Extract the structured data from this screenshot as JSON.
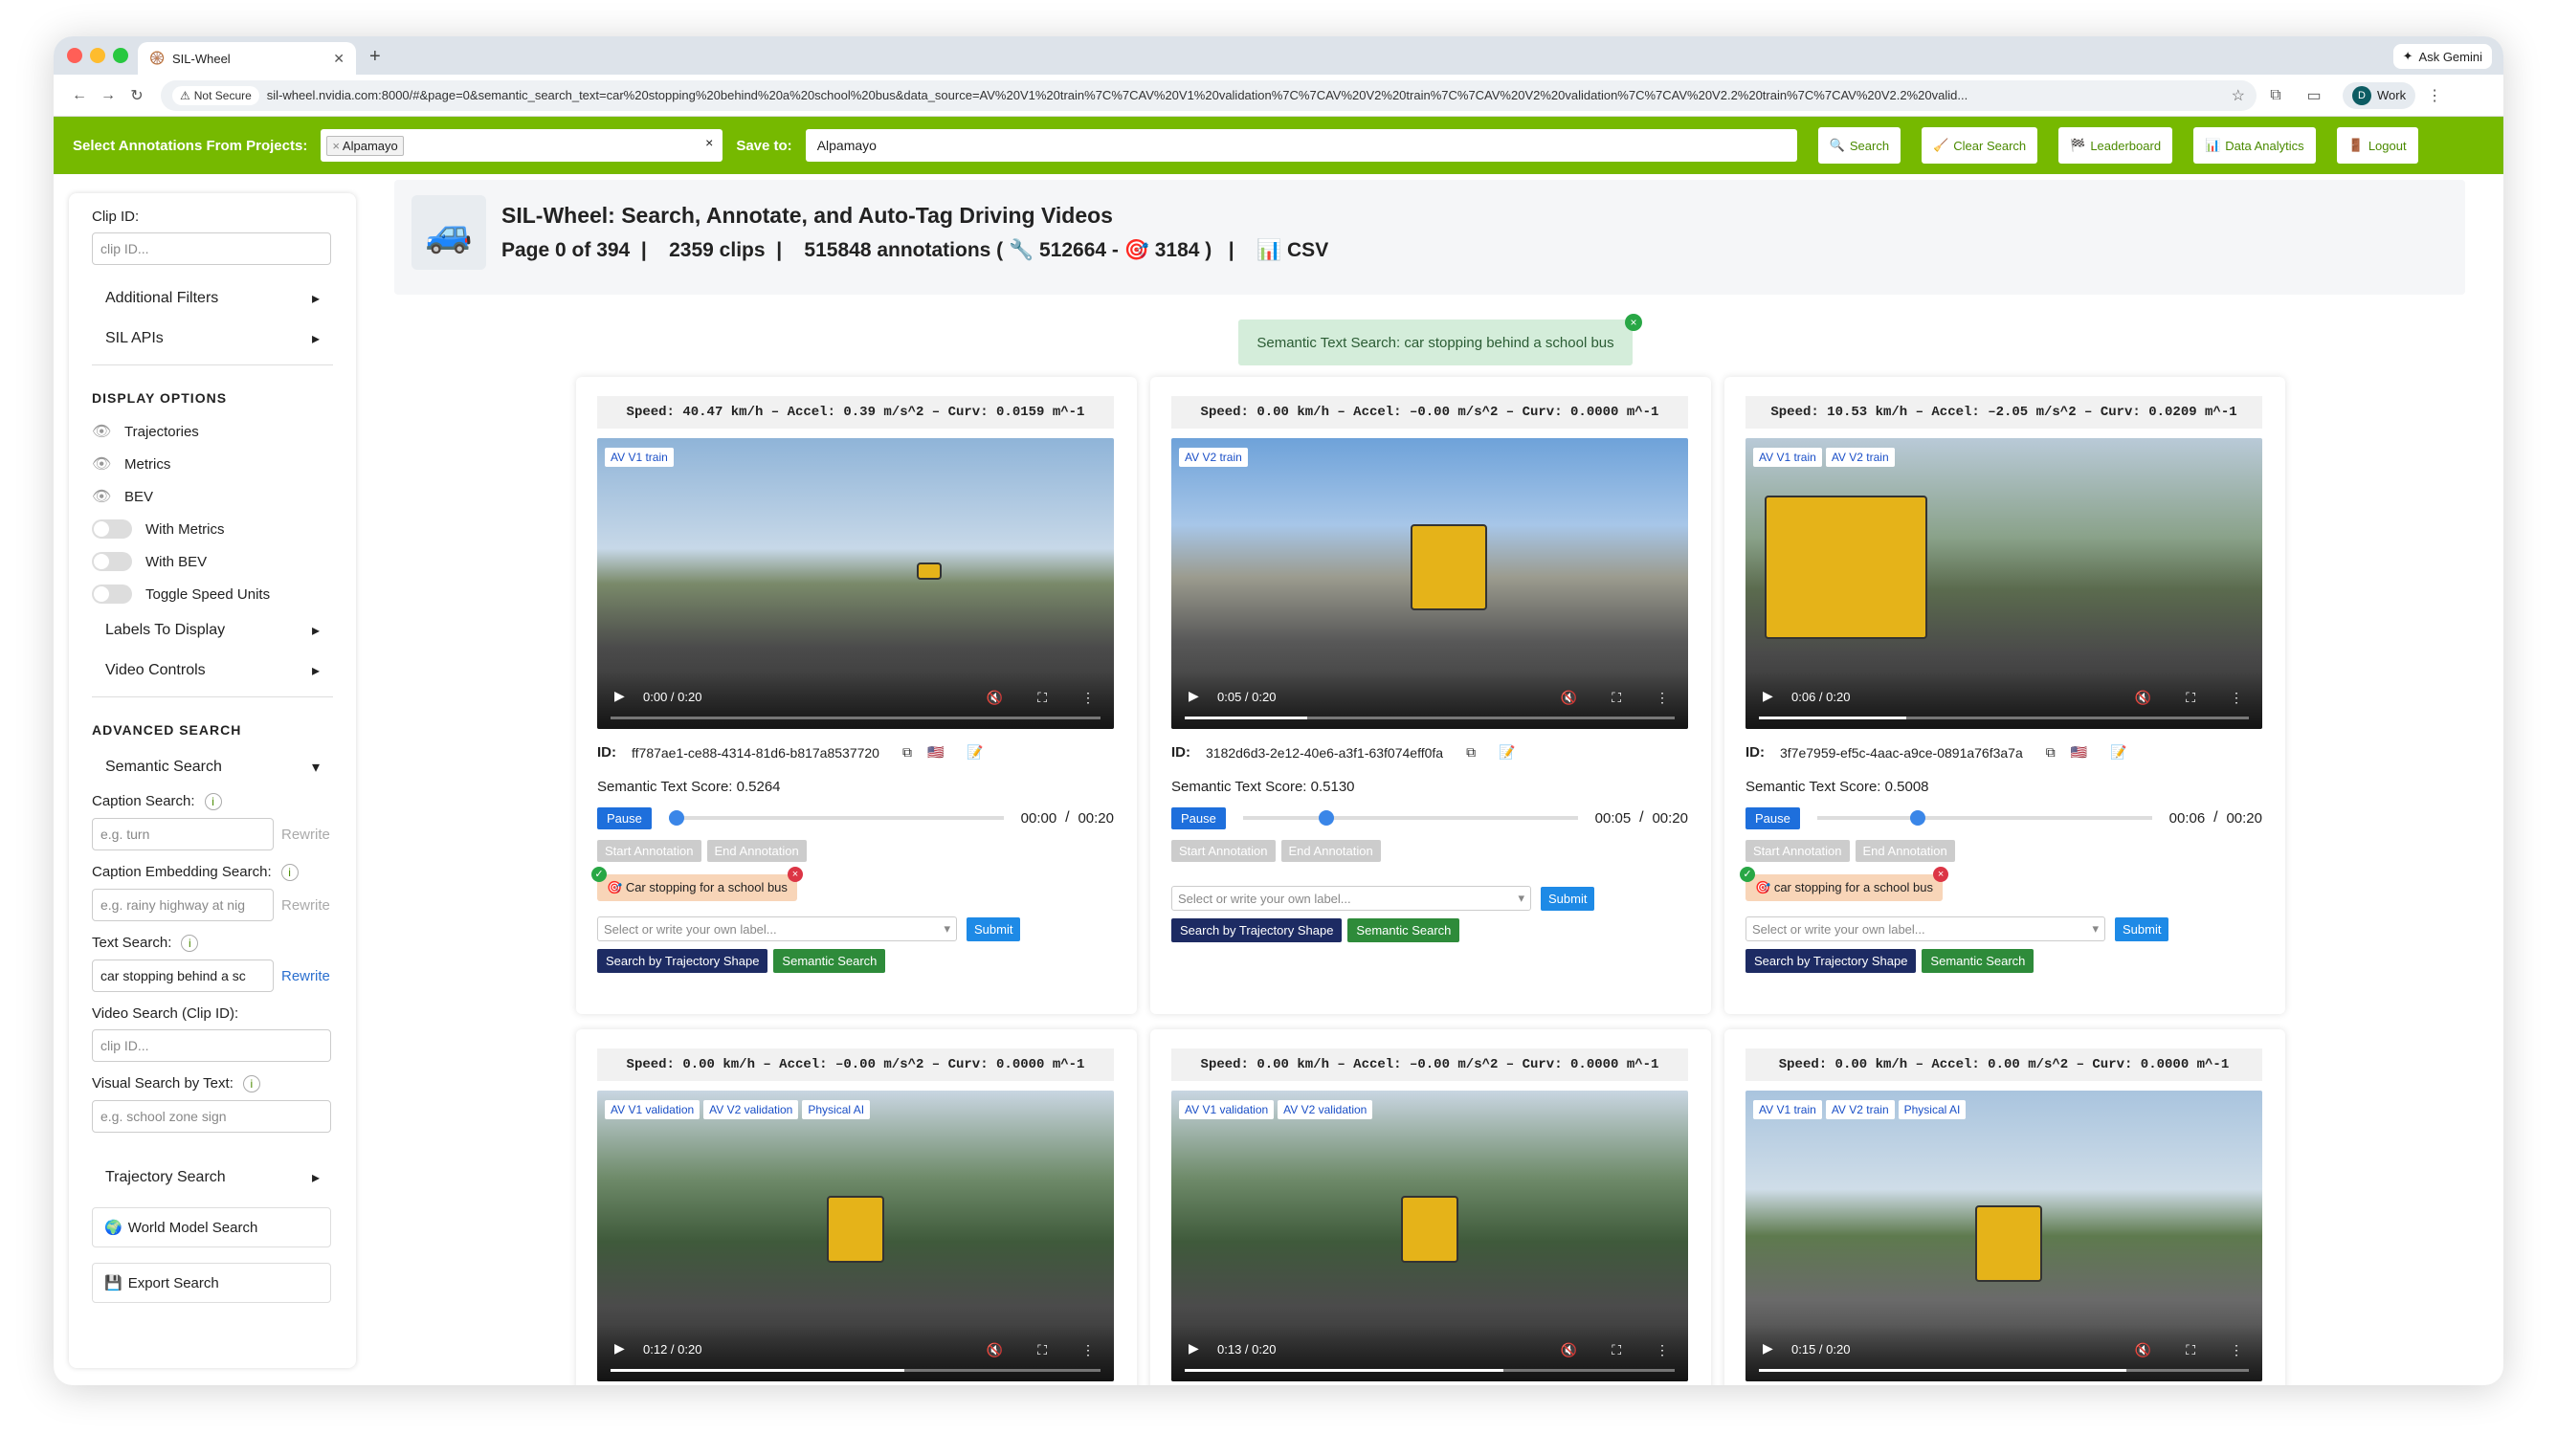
{
  "browser": {
    "tab_title": "SIL-Wheel",
    "new_tab": "+",
    "ask_gemini": "Ask Gemini",
    "not_secure": "Not Secure",
    "url": "sil-wheel.nvidia.com:8000/#&page=0&semantic_search_text=car%20stopping%20behind%20a%20school%20bus&data_source=AV%20V1%20train%7C%7CAV%20V1%20validation%7C%7CAV%20V2%20train%7C%7CAV%20V2%20validation%7C%7CAV%20V2.2%20train%7C%7CAV%20V2.2%20valid...",
    "profile_label": "Work",
    "profile_initial": "D"
  },
  "topbar": {
    "select_label": "Select Annotations From Projects:",
    "project_chip": "Alpamayo",
    "save_label": "Save to:",
    "save_value": "Alpamayo",
    "buttons": [
      {
        "icon": "🔍",
        "label": "Search"
      },
      {
        "icon": "🧹",
        "label": "Clear Search"
      },
      {
        "icon": "🏁",
        "label": "Leaderboard"
      },
      {
        "icon": "📊",
        "label": "Data Analytics"
      },
      {
        "icon": "🚪",
        "label": "Logout"
      }
    ]
  },
  "sidebar": {
    "clip_id_label": "Clip ID:",
    "clip_id_placeholder": "clip ID...",
    "additional_filters": "Additional Filters",
    "sil_apis": "SIL APIs",
    "display_options": "DISPLAY OPTIONS",
    "trajectories": "Trajectories",
    "metrics": "Metrics",
    "bev": "BEV",
    "with_metrics": "With Metrics",
    "with_bev": "With BEV",
    "toggle_speed_units": "Toggle Speed Units",
    "labels_to_display": "Labels To Display",
    "video_controls": "Video Controls",
    "advanced_search": "ADVANCED SEARCH",
    "semantic_search": "Semantic Search",
    "caption_search_label": "Caption Search:",
    "caption_search_placeholder": "e.g. turn",
    "caption_embedding_label": "Caption Embedding Search:",
    "caption_embedding_placeholder": "e.g. rainy highway at nig",
    "text_search_label": "Text Search:",
    "text_search_value": "car stopping behind a sc",
    "rewrite": "Rewrite",
    "video_search_label": "Video Search (Clip ID):",
    "video_search_placeholder": "clip ID...",
    "visual_search_label": "Visual Search by Text:",
    "visual_search_placeholder": "e.g. school zone sign",
    "trajectory_search": "Trajectory Search",
    "world_model_search": "World Model Search",
    "export_search": "Export Search"
  },
  "header": {
    "title": "SIL-Wheel: Search, Annotate, and Auto-Tag Driving Videos",
    "page": "Page 0 of 394",
    "clips": "2359 clips",
    "annotations": "515848 annotations (",
    "count_a": "512664",
    "count_b": "3184",
    "csv": "CSV"
  },
  "semantic_banner": "Semantic Text Search: car stopping behind a school bus",
  "common": {
    "id_label": "ID:",
    "pause": "Pause",
    "start_annotation": "Start Annotation",
    "end_annotation": "End Annotation",
    "select_placeholder": "Select or write your own label...",
    "submit": "Submit",
    "traj_search": "Search by Trajectory Shape",
    "semantic_search": "Semantic Search"
  },
  "cards": [
    {
      "speed": "Speed: 40.47 km/h – Accel:  0.39 m/s^2 – Curv: 0.0159 m^-1",
      "tags": [
        "AV V1 train"
      ],
      "time": "0:00 / 0:20",
      "progress": 0.0,
      "id": "ff787ae1-ce88-4314-81d6-b817a8537720",
      "score": "Semantic Text Score: 0.5264",
      "cur": "00:00",
      "dur": "00:20",
      "label": "Car stopping for a school bus"
    },
    {
      "speed": "Speed: 0.00 km/h – Accel: –0.00 m/s^2 – Curv: 0.0000 m^-1",
      "tags": [
        "AV V2 train"
      ],
      "time": "0:05 / 0:20",
      "progress": 0.25,
      "id": "3182d6d3-2e12-40e6-a3f1-63f074eff0fa",
      "score": "Semantic Text Score: 0.5130",
      "cur": "00:05",
      "dur": "00:20",
      "label": ""
    },
    {
      "speed": "Speed: 10.53 km/h – Accel: –2.05 m/s^2 – Curv: 0.0209 m^-1",
      "tags": [
        "AV V1 train",
        "AV V2 train"
      ],
      "time": "0:06 / 0:20",
      "progress": 0.3,
      "id": "3f7e7959-ef5c-4aac-a9ce-0891a76f3a7a",
      "score": "Semantic Text Score: 0.5008",
      "cur": "00:06",
      "dur": "00:20",
      "label": "car stopping for a school bus"
    },
    {
      "speed": "Speed: 0.00 km/h – Accel: –0.00 m/s^2 – Curv: 0.0000 m^-1",
      "tags": [
        "AV V1 validation",
        "AV V2 validation",
        "Physical AI"
      ],
      "time": "0:12 / 0:20",
      "progress": 0.6
    },
    {
      "speed": "Speed: 0.00 km/h – Accel: –0.00 m/s^2 – Curv: 0.0000 m^-1",
      "tags": [
        "AV V1 validation",
        "AV V2 validation"
      ],
      "time": "0:13 / 0:20",
      "progress": 0.65
    },
    {
      "speed": "Speed: 0.00 km/h – Accel:  0.00 m/s^2 – Curv: 0.0000 m^-1",
      "tags": [
        "AV V1 train",
        "AV V2 train",
        "Physical AI"
      ],
      "time": "0:15 / 0:20",
      "progress": 0.75
    }
  ]
}
